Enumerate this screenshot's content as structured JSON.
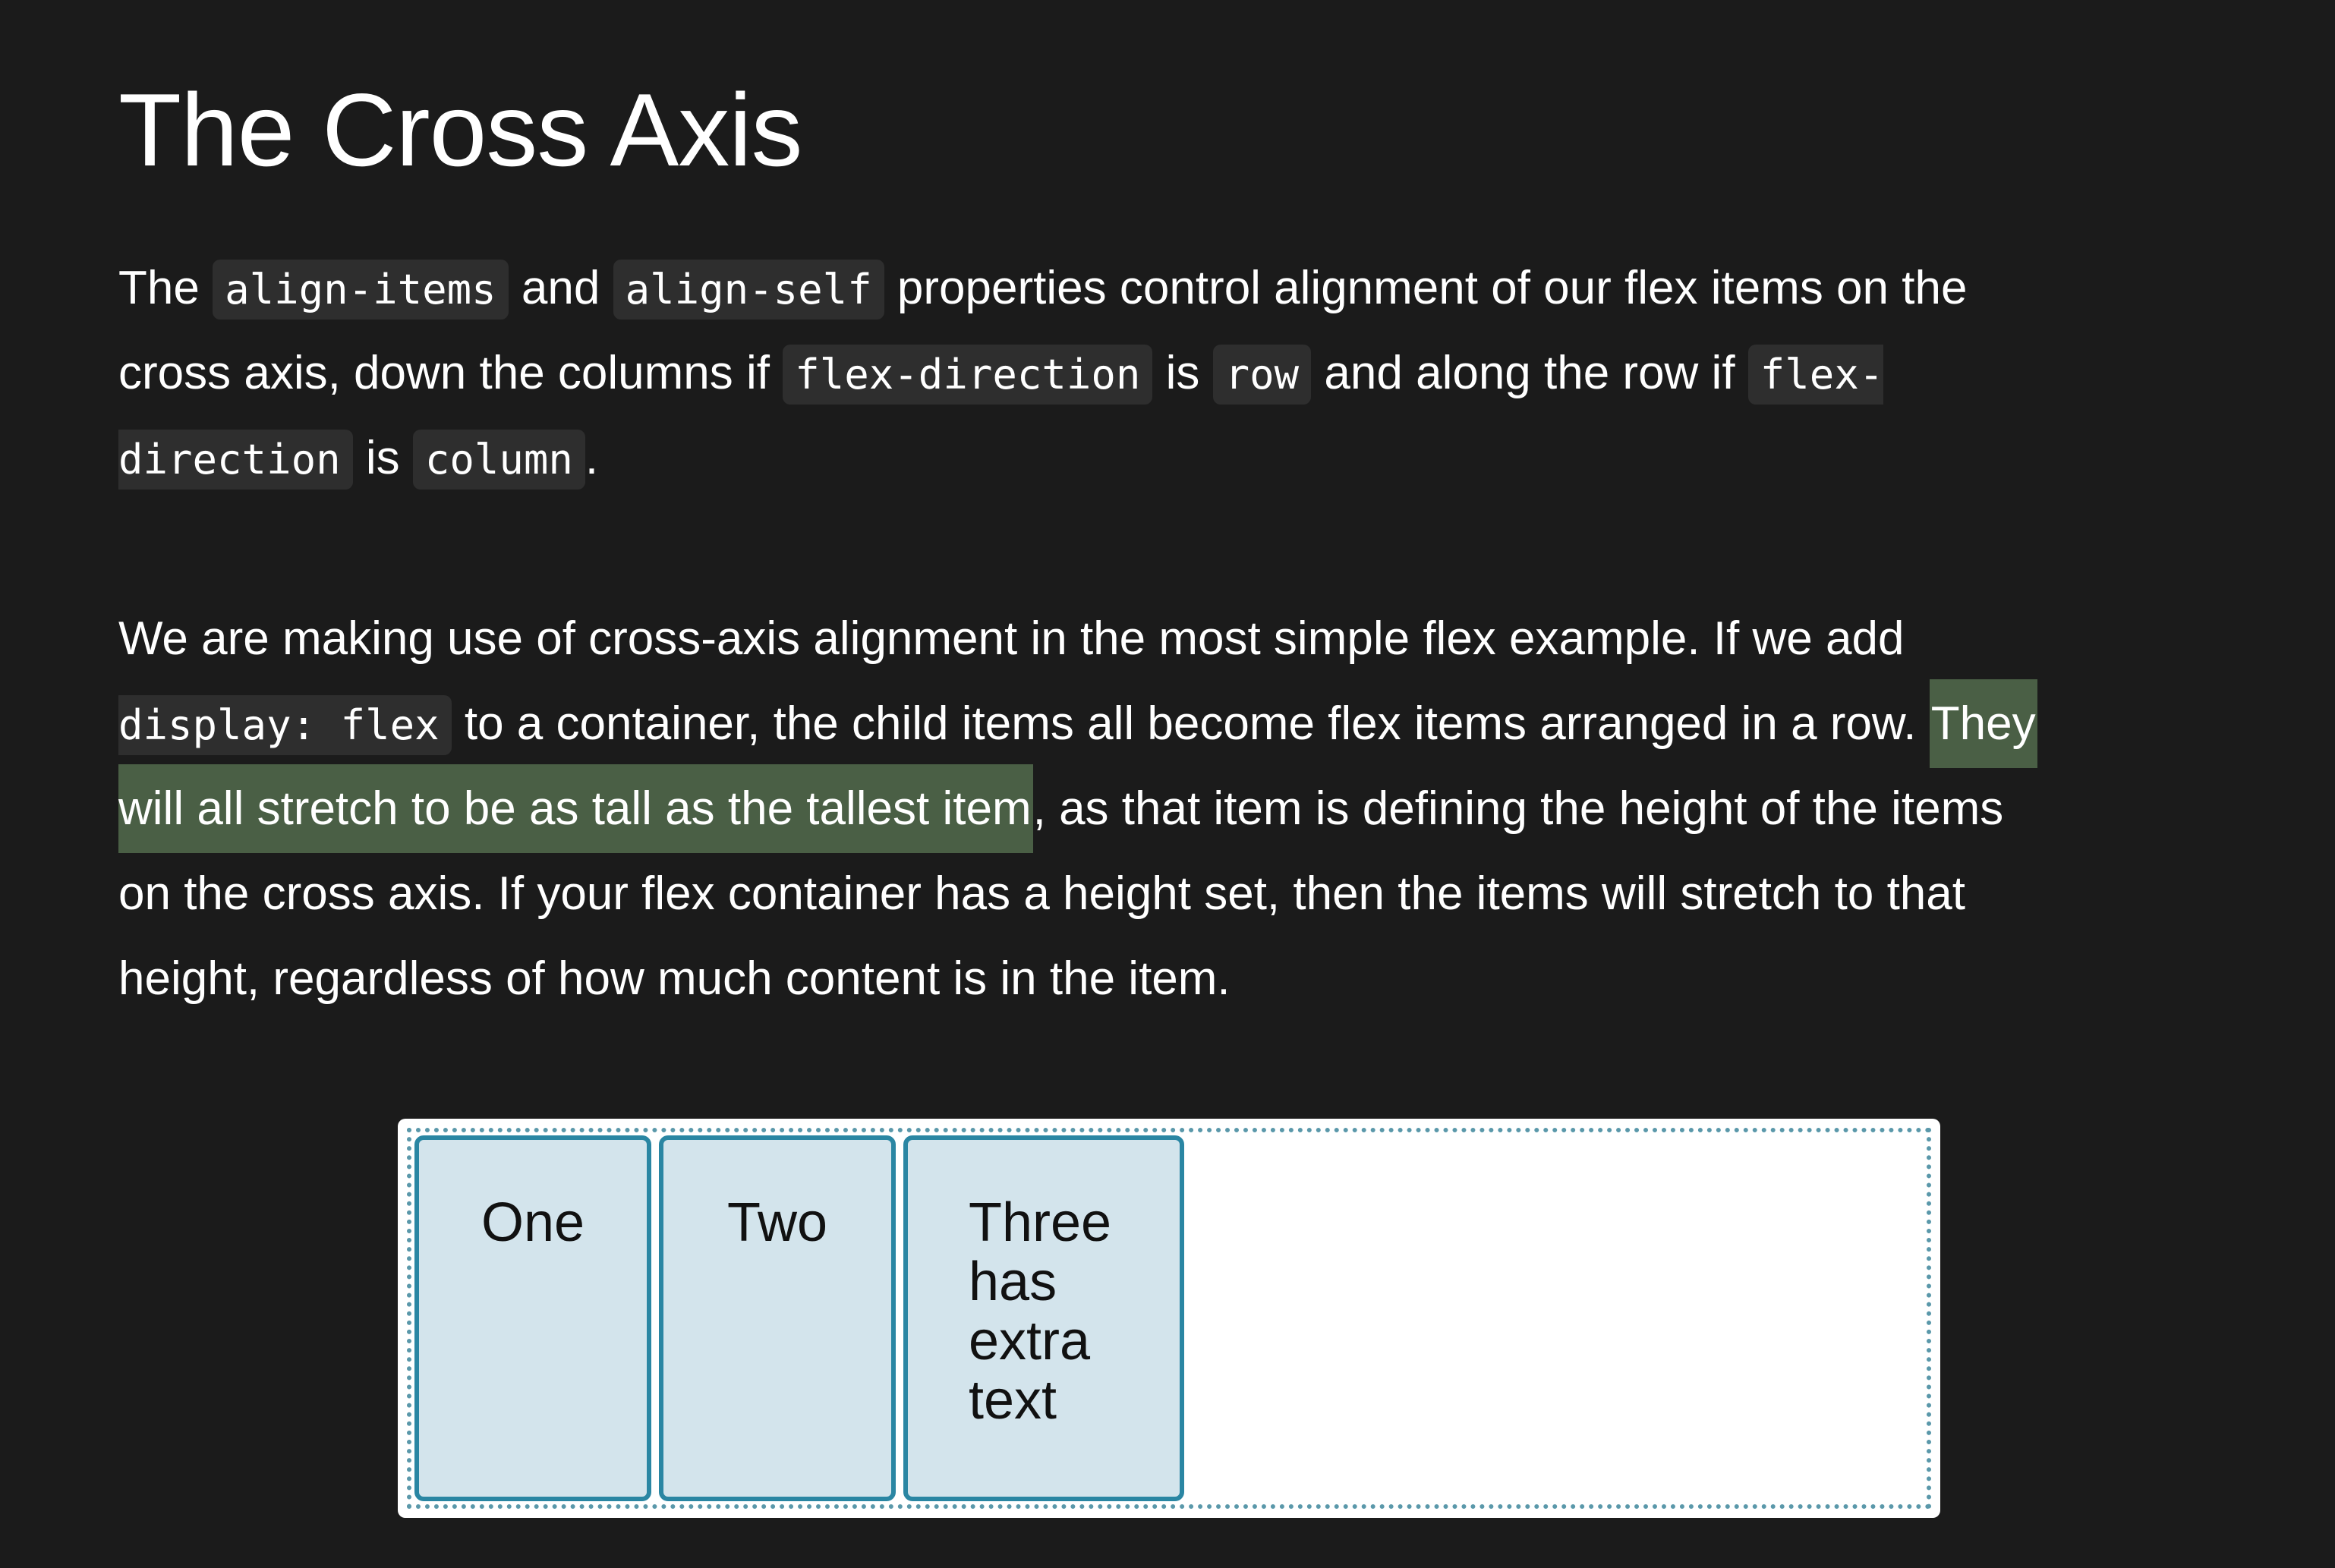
{
  "heading": "The Cross Axis",
  "paragraph1": {
    "line1": {
      "t1": "The ",
      "c1": "align-items",
      "t2": " and ",
      "c2": "align-self",
      "t3": " properties control alignment of our flex items on the"
    },
    "line2": {
      "t1": "cross axis, down the columns if ",
      "c1": "flex-direction",
      "t2": " is ",
      "c2": "row",
      "t3": " and along the row if ",
      "c3": "flex-"
    },
    "line3": {
      "c1": "direction",
      "t1": " is ",
      "c2": "column",
      "t2": "."
    }
  },
  "paragraph2": {
    "line1": "We are making use of cross-axis alignment in the most simple flex example. If we add",
    "line2": {
      "c1": "display: flex",
      "t1": " to a container, the child items all become flex items arranged in a row. ",
      "h1": "They"
    },
    "line3": {
      "h1": "will all stretch to be as tall as the tallest item",
      "t1": ", as that item is defining the height of the items"
    },
    "line4": "on the cross axis. If your flex container has a height set, then the items will stretch to that",
    "line5": "height, regardless of how much content is in the item."
  },
  "example": {
    "items": [
      "One",
      "Two",
      "Three has extra text"
    ],
    "colors": {
      "item_background": "#d3e4ec",
      "item_border": "#2a86a3",
      "container_border": "#5a98aa",
      "highlight": "#4a5f45",
      "page_background": "#1b1b1b",
      "code_background": "#2e2e2e"
    }
  }
}
